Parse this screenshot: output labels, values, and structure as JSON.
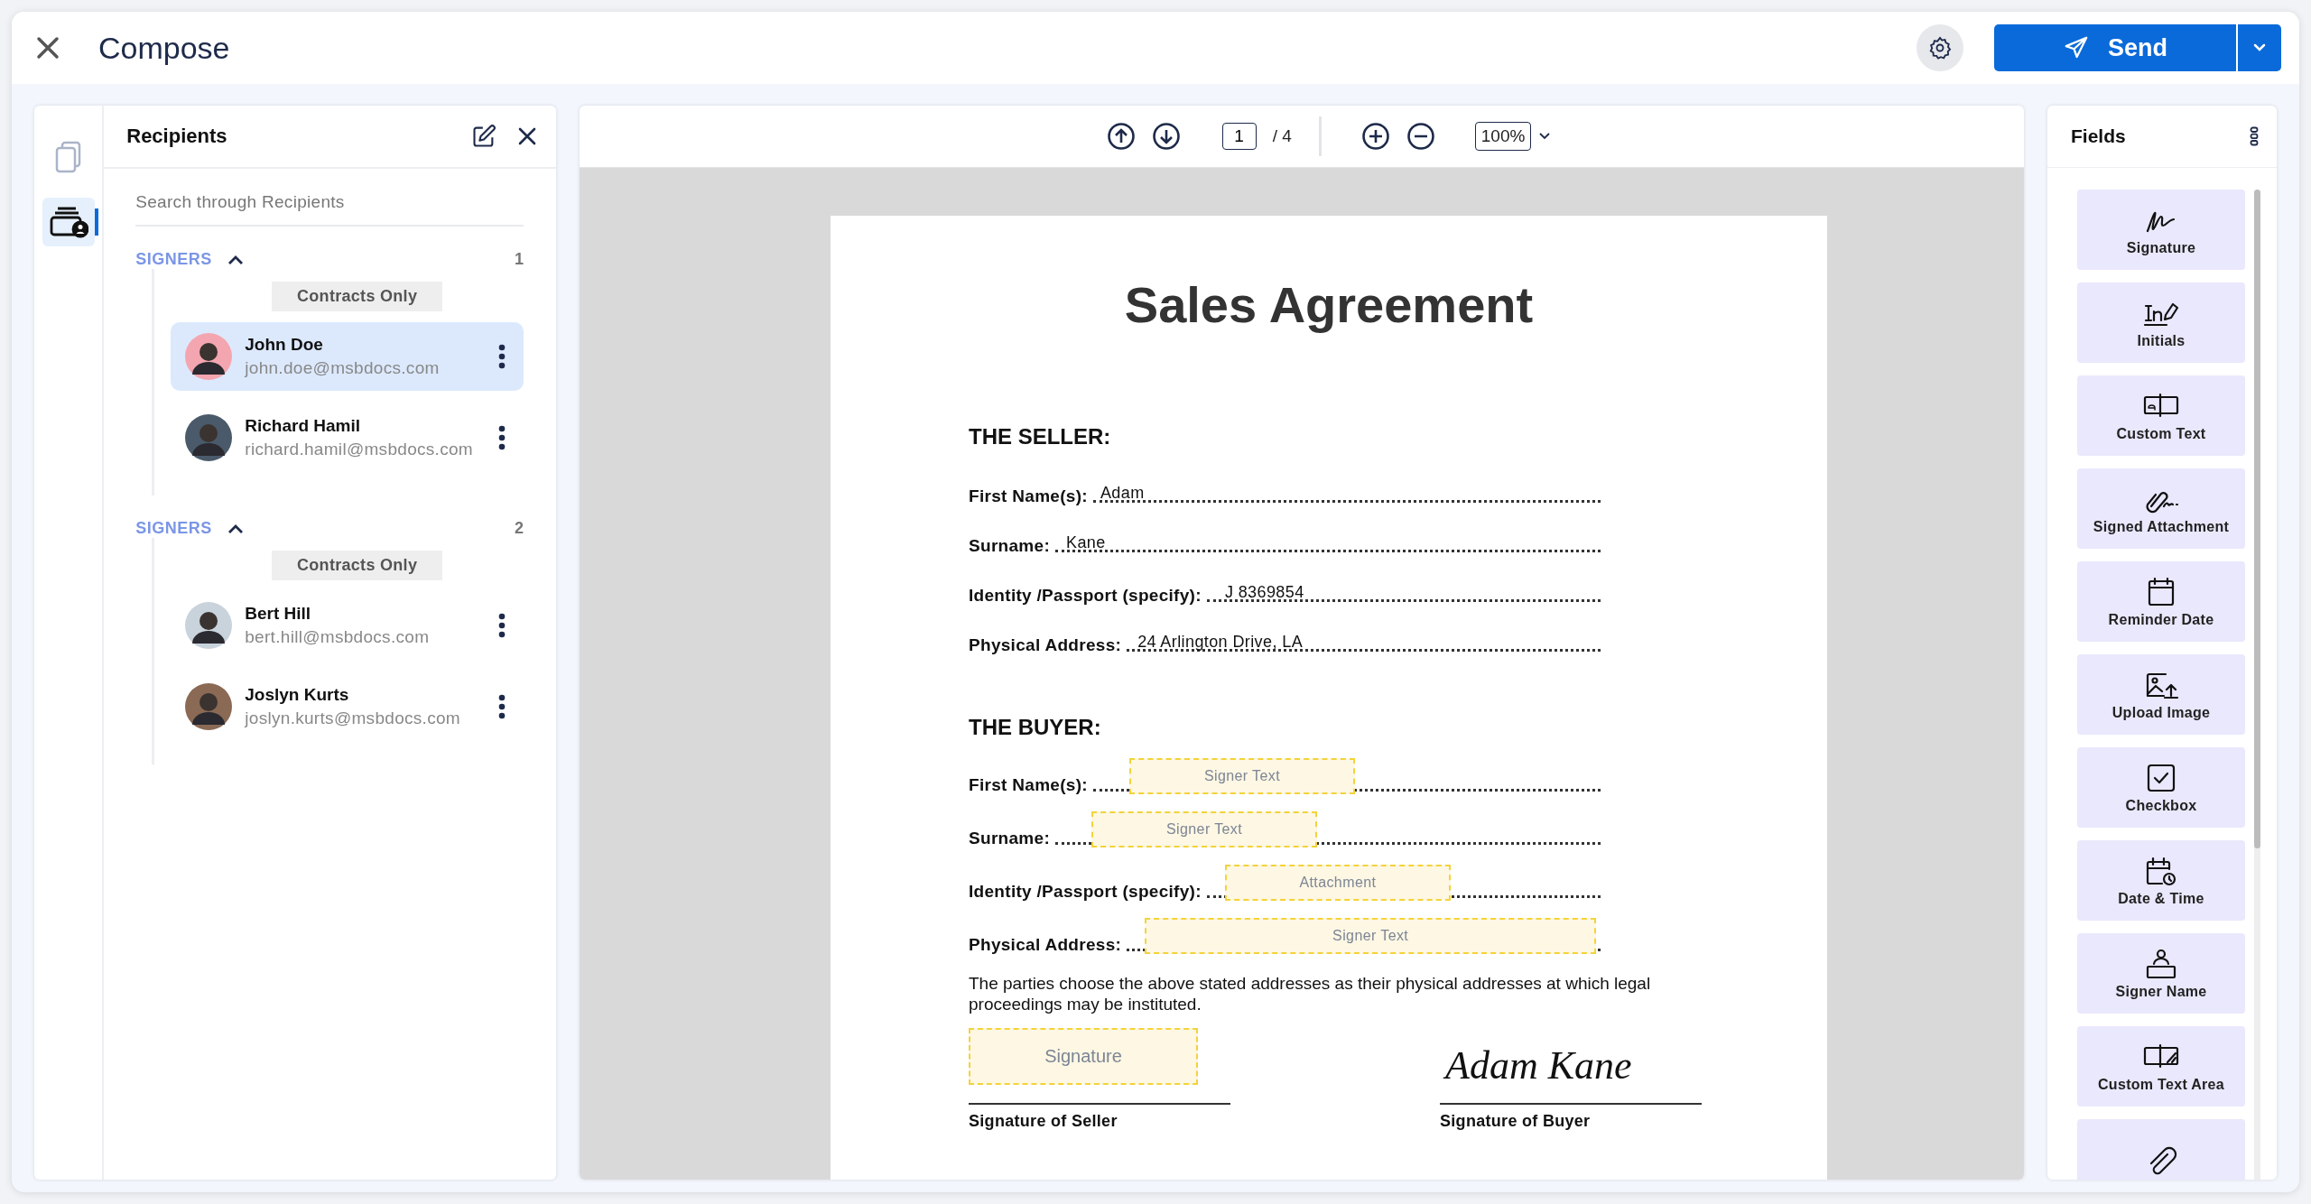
{
  "header": {
    "title": "Compose",
    "send_button": "Send"
  },
  "rail": [
    {
      "kind": "documents",
      "selected": false
    },
    {
      "kind": "recipients",
      "selected": true
    }
  ],
  "recipients": {
    "title": "Recipients",
    "search": {
      "placeholder": "Search through Recipients"
    },
    "groups": [
      {
        "label": "SIGNERS",
        "count": "1",
        "expanded": true,
        "tag": "Contracts Only",
        "people": [
          {
            "name": "John Doe",
            "email": "john.doe@msbdocs.com",
            "selected": true
          },
          {
            "name": "Richard Hamil",
            "email": "richard.hamil@msbdocs.com",
            "selected": false
          }
        ]
      },
      {
        "label": "SIGNERS",
        "count": "2",
        "expanded": true,
        "tag": "Contracts Only",
        "people": [
          {
            "name": "Bert Hill",
            "email": "bert.hill@msbdocs.com",
            "selected": false
          },
          {
            "name": "Joslyn Kurts",
            "email": "joslyn.kurts@msbdocs.com",
            "selected": false
          }
        ]
      }
    ]
  },
  "viewer": {
    "page": "1",
    "page_count": "/ 4",
    "zoom": "100%"
  },
  "document": {
    "title": "Sales Agreement",
    "sections": [
      {
        "heading": "THE SELLER:",
        "fields": [
          {
            "label": "First Name(s):",
            "kind": "value",
            "value": "Adam"
          },
          {
            "label": "Surname:",
            "kind": "value",
            "value": "Kane"
          },
          {
            "label": "Identity /Passport (specify):",
            "kind": "value",
            "value": "J 8369854"
          },
          {
            "label": "Physical Address:",
            "kind": "value",
            "value": "24 Arlington Drive, LA"
          }
        ]
      },
      {
        "heading": "THE BUYER:",
        "fields": [
          {
            "label": "First Name(s):",
            "kind": "placeholder",
            "placeholder": "Signer Text"
          },
          {
            "label": "Surname:",
            "kind": "placeholder",
            "placeholder": "Signer Text"
          },
          {
            "label": "Identity /Passport (specify):",
            "kind": "placeholder",
            "placeholder": "Attachment"
          },
          {
            "label": "Physical Address:",
            "kind": "placeholder",
            "placeholder": "Signer Text"
          }
        ]
      }
    ],
    "note": "The parties choose the above stated addresses as their physical addresses at which legal proceedings may be instituted.",
    "signatures": [
      {
        "kind": "placeholder",
        "text": "Signature",
        "caption": "Signature of Seller"
      },
      {
        "kind": "signed",
        "text": "Adam Kane",
        "caption": "Signature of Buyer"
      }
    ]
  },
  "fields_panel": {
    "title": "Fields",
    "items": [
      {
        "kind": "signature",
        "label": "Signature"
      },
      {
        "kind": "initials",
        "label": "Initials"
      },
      {
        "kind": "custom_text",
        "label": "Custom Text"
      },
      {
        "kind": "signed_attachment",
        "label": "Signed Attachment"
      },
      {
        "kind": "reminder_date",
        "label": "Reminder Date"
      },
      {
        "kind": "upload_image",
        "label": "Upload Image"
      },
      {
        "kind": "checkbox",
        "label": "Checkbox"
      },
      {
        "kind": "date_time",
        "label": "Date & Time"
      },
      {
        "kind": "signer_name",
        "label": "Signer Name"
      },
      {
        "kind": "custom_text_area",
        "label": "Custom Text Area"
      },
      {
        "kind": "attachment"
      }
    ]
  }
}
